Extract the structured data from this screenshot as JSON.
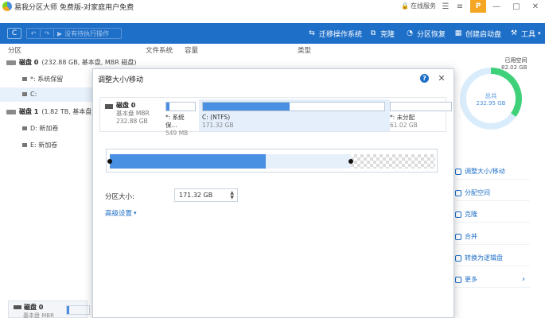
{
  "window": {
    "title": "易我分区大师 免费版-对家庭用户免费",
    "service_label": "在线服务",
    "upgrade_label": "P"
  },
  "toolbar": {
    "refresh_label": "C",
    "undo_label": "↶",
    "redo_label": "↷",
    "pending_label": "没有待执行操作",
    "migrate_label": "迁移操作系统",
    "clone_label": "克隆",
    "recover_label": "分区恢复",
    "bootdisk_label": "创建启动盘",
    "tools_label": "工具"
  },
  "table": {
    "headers": [
      "分区",
      "文件系统",
      "容量",
      "类型"
    ],
    "rows": [
      {
        "disk": "磁盘 0",
        "info": "(232.88 GB, 基本盘, MBR 磁盘)"
      },
      {
        "label": "*: 系统保留"
      },
      {
        "label": "C:"
      },
      {
        "disk": "磁盘 1",
        "info": "(1.82 TB, 基本盘, MBR 磁盘)"
      },
      {
        "label": "D: 新加卷"
      },
      {
        "label": "E: 新加卷"
      }
    ],
    "bottom_disk": {
      "name": "磁盘 0",
      "sub": "基本盘 MBR"
    }
  },
  "disk_usage": {
    "used_label": "已用空间",
    "used_value": "82.02 GB",
    "total_label": "总共",
    "total_value": "232.95 GB",
    "used_fraction": 0.35,
    "color_used": "#3fd17a",
    "color_free": "#d9ecfb"
  },
  "operations": [
    {
      "label": "调整大小/移动"
    },
    {
      "label": "分配空间"
    },
    {
      "label": "克隆"
    },
    {
      "label": "合并"
    },
    {
      "label": "转换为逻辑盘"
    },
    {
      "label": "更多",
      "arrow": "›"
    }
  ],
  "dialog": {
    "title": "调整大小/移动",
    "help_label": "?",
    "close_label": "✕",
    "disk": {
      "name": "磁盘 0",
      "type": "基本盘 MBR",
      "size": "232.88 GB"
    },
    "segments": [
      {
        "name": "*: 系统保...",
        "size": "549 MB",
        "fill_fraction": 0.1
      },
      {
        "name": "C: (NTFS)",
        "size": "171.32 GB",
        "fill_fraction": 0.48
      },
      {
        "name": "*: 未分配",
        "size": "61.02 GB",
        "fill_fraction": 0.0
      }
    ],
    "resize": {
      "used_fraction": 0.48,
      "partition_fraction": 0.74
    },
    "size_label": "分区大小:",
    "size_value": "171.32 GB",
    "advanced_label": "高级设置"
  },
  "colors": {
    "accent": "#1e6fc8",
    "partition_fill": "#4a90e2"
  }
}
